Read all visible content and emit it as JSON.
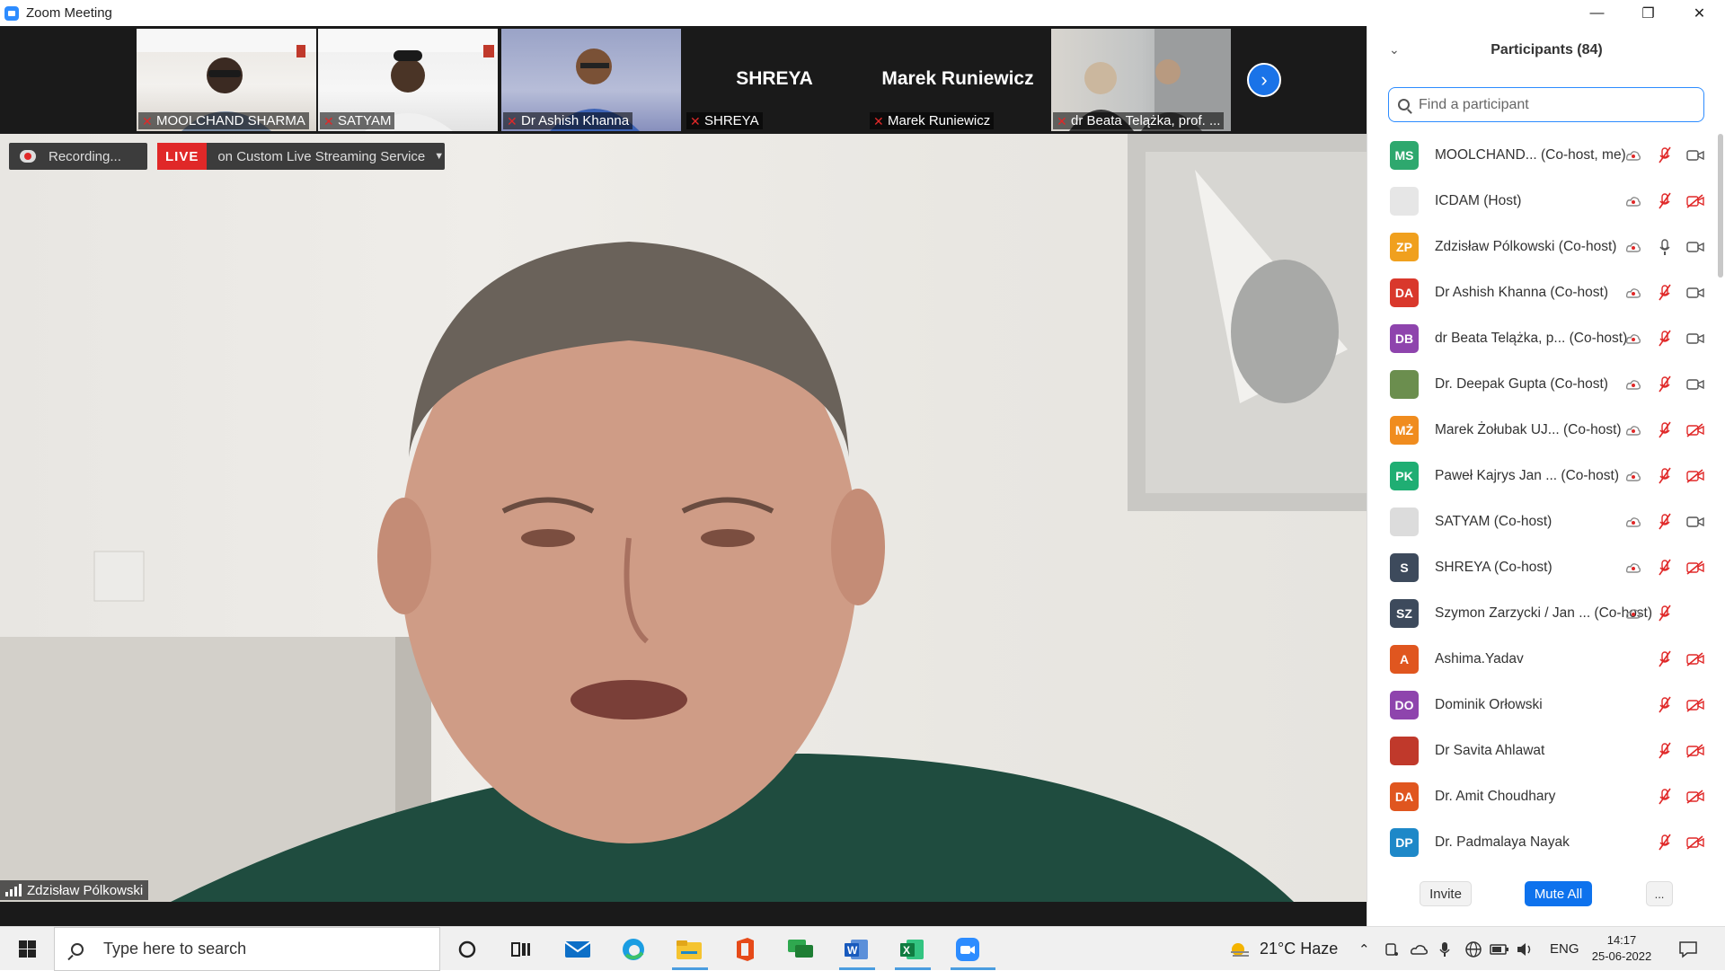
{
  "window": {
    "title": "Zoom Meeting",
    "minimize": "—",
    "restore": "❐",
    "close": "✕"
  },
  "strip": {
    "tiles": [
      {
        "name": "MOOLCHAND SHARMA"
      },
      {
        "name": "SATYAM"
      },
      {
        "name": "Dr Ashish Khanna"
      },
      {
        "name": "SHREYA",
        "big": "SHREYA"
      },
      {
        "name": "Marek Runiewicz",
        "big": "Marek Runiewicz"
      },
      {
        "name": "dr Beata Telążka, prof. ..."
      }
    ],
    "next_icon": "chevron-right-icon"
  },
  "main": {
    "recording_label": "Recording...",
    "live_badge": "LIVE",
    "live_service": "on Custom Live Streaming Service",
    "speaker_name": "Zdzisław Pólkowski"
  },
  "participants": {
    "title": "Participants (84)",
    "search_placeholder": "Find a participant",
    "list": [
      {
        "initials": "MS",
        "color": "#2ea86e",
        "name": "MOOLCHAND...  (Co-host, me)",
        "rec": true,
        "cam": "video"
      },
      {
        "initials": "",
        "color": "#e6e6e6",
        "name": "ICDAM (Host)",
        "rec": true,
        "cam": "video-off"
      },
      {
        "initials": "ZP",
        "color": "#f0a01e",
        "name": "Zdzisław Pólkowski (Co-host)",
        "rec": true,
        "cam": "video"
      },
      {
        "initials": "DA",
        "color": "#d9382c",
        "name": "Dr Ashish Khanna (Co-host)",
        "rec": true,
        "cam": "video"
      },
      {
        "initials": "DB",
        "color": "#8e44ad",
        "name": "dr Beata Telążka, p...  (Co-host)",
        "rec": true,
        "cam": "video"
      },
      {
        "initials": "",
        "color": "#6b8e4e",
        "name": "Dr. Deepak Gupta (Co-host)",
        "rec": true,
        "cam": "video"
      },
      {
        "initials": "MŻ",
        "color": "#f08c1e",
        "name": "Marek Żołubak UJ...  (Co-host)",
        "rec": true,
        "cam": "video-off"
      },
      {
        "initials": "PK",
        "color": "#1fae73",
        "name": "Paweł Kajrys Jan ...  (Co-host)",
        "rec": true,
        "cam": "video-off"
      },
      {
        "initials": "",
        "color": "#dcdcdc",
        "name": "SATYAM (Co-host)",
        "rec": true,
        "cam": "video"
      },
      {
        "initials": "S",
        "color": "#3d4a5c",
        "name": "SHREYA (Co-host)",
        "rec": true,
        "cam": "video-off"
      },
      {
        "initials": "SZ",
        "color": "#3d4a5c",
        "name": "Szymon Zarzycki / Jan ...  (Co-host)",
        "rec": true,
        "cam": "none"
      },
      {
        "initials": "A",
        "color": "#e0561f",
        "name": "Ashima.Yadav",
        "rec": false,
        "cam": "video-off"
      },
      {
        "initials": "DO",
        "color": "#8e44ad",
        "name": "Dominik Orłowski",
        "rec": false,
        "cam": "video-off"
      },
      {
        "initials": "",
        "color": "#c0392b",
        "name": "Dr Savita Ahlawat",
        "rec": false,
        "cam": "video-off"
      },
      {
        "initials": "DA",
        "color": "#e0561f",
        "name": "Dr. Amit Choudhary",
        "rec": false,
        "cam": "video-off"
      },
      {
        "initials": "DP",
        "color": "#1e88c8",
        "name": "Dr. Padmalaya Nayak",
        "rec": false,
        "cam": "video-off"
      }
    ],
    "invite_label": "Invite",
    "mute_all_label": "Mute All",
    "more_label": "..."
  },
  "taskbar": {
    "search_label": "Type here to search",
    "weather": "21°C  Haze",
    "lang": "ENG",
    "time": "14:17",
    "date": "25-06-2022"
  }
}
